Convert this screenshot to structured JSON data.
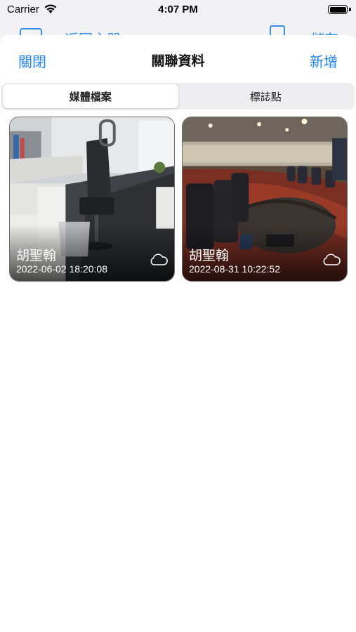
{
  "status_bar": {
    "carrier": "Carrier",
    "time": "4:07 PM",
    "battery_level": 1.0
  },
  "underlying_nav": {
    "back_label": "返回主器",
    "save_label": "儲存"
  },
  "sheet": {
    "close_label": "關閉",
    "title": "關聯資料",
    "add_label": "新增",
    "segments": [
      {
        "label": "媒體檔案",
        "selected": true
      },
      {
        "label": "標誌點",
        "selected": false
      }
    ]
  },
  "media": [
    {
      "name": "胡聖翰",
      "datetime": "2022-06-02 18:20:08",
      "icon": "cloud-icon"
    },
    {
      "name": "胡聖翰",
      "datetime": "2022-08-31 10:22:52",
      "icon": "cloud-icon"
    }
  ],
  "colors": {
    "accent": "#1f83f5",
    "background": "#ffffff",
    "segment_bg": "#eeeef0"
  }
}
